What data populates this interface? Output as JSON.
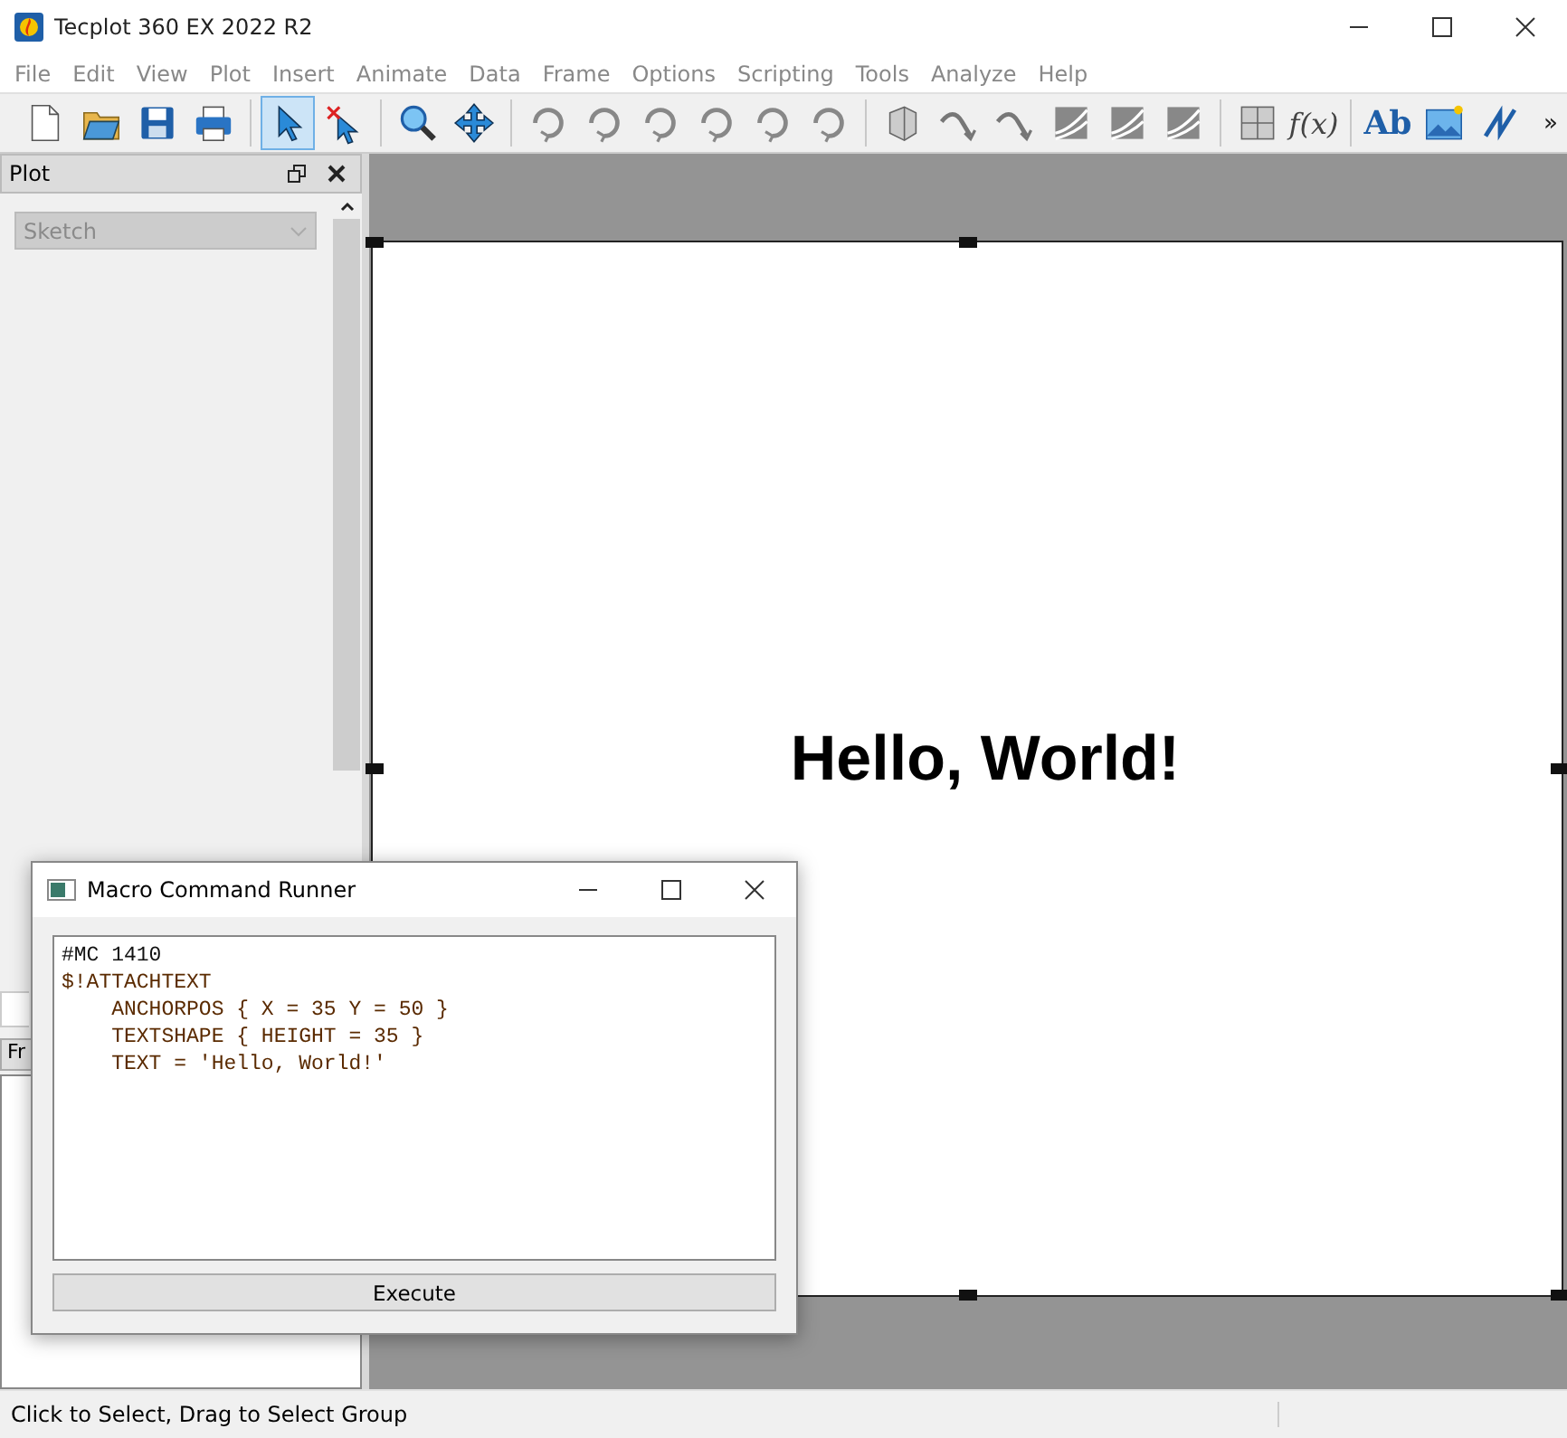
{
  "window": {
    "title": "Tecplot 360 EX 2022 R2"
  },
  "menu": [
    "File",
    "Edit",
    "View",
    "Plot",
    "Insert",
    "Animate",
    "Data",
    "Frame",
    "Options",
    "Scripting",
    "Tools",
    "Analyze",
    "Help"
  ],
  "toolbar": [
    {
      "kind": "new",
      "selected": false
    },
    {
      "kind": "open",
      "selected": false
    },
    {
      "kind": "save",
      "selected": false
    },
    {
      "kind": "print",
      "selected": false
    },
    {
      "kind": "sep"
    },
    {
      "kind": "select",
      "selected": true
    },
    {
      "kind": "adjust",
      "selected": false
    },
    {
      "kind": "sep"
    },
    {
      "kind": "zoom",
      "selected": false
    },
    {
      "kind": "move",
      "selected": false
    },
    {
      "kind": "sep"
    },
    {
      "kind": "rotate",
      "selected": false
    },
    {
      "kind": "rotate",
      "selected": false
    },
    {
      "kind": "rotate",
      "selected": false
    },
    {
      "kind": "rotate",
      "selected": false
    },
    {
      "kind": "rotate",
      "selected": false
    },
    {
      "kind": "rotate",
      "selected": false
    },
    {
      "kind": "sep"
    },
    {
      "kind": "probe",
      "selected": false
    },
    {
      "kind": "curve",
      "selected": false
    },
    {
      "kind": "curve",
      "selected": false
    },
    {
      "kind": "contour",
      "selected": false
    },
    {
      "kind": "contour",
      "selected": false
    },
    {
      "kind": "contour",
      "selected": false
    },
    {
      "kind": "sep"
    },
    {
      "kind": "grid",
      "selected": false
    },
    {
      "kind": "func",
      "text": "f(x)",
      "selected": false
    },
    {
      "kind": "sep"
    },
    {
      "kind": "text",
      "text": "Ab",
      "selected": false
    },
    {
      "kind": "image",
      "selected": false
    },
    {
      "kind": "line",
      "selected": false
    }
  ],
  "toolbar_overflow": "»",
  "sidebar": {
    "title": "Plot",
    "dropdown": {
      "value": "Sketch",
      "disabled": true
    },
    "frame_label": "Fr"
  },
  "canvas": {
    "text": "Hello, World!"
  },
  "dialog": {
    "title": "Macro Command Runner",
    "code": [
      "#MC 1410",
      "$!ATTACHTEXT",
      "    ANCHORPOS { X = 35 Y = 50 }",
      "    TEXTSHAPE { HEIGHT = 35 }",
      "    TEXT = 'Hello, World!'"
    ],
    "button": "Execute"
  },
  "status_bar": "Click to Select, Drag to Select Group"
}
